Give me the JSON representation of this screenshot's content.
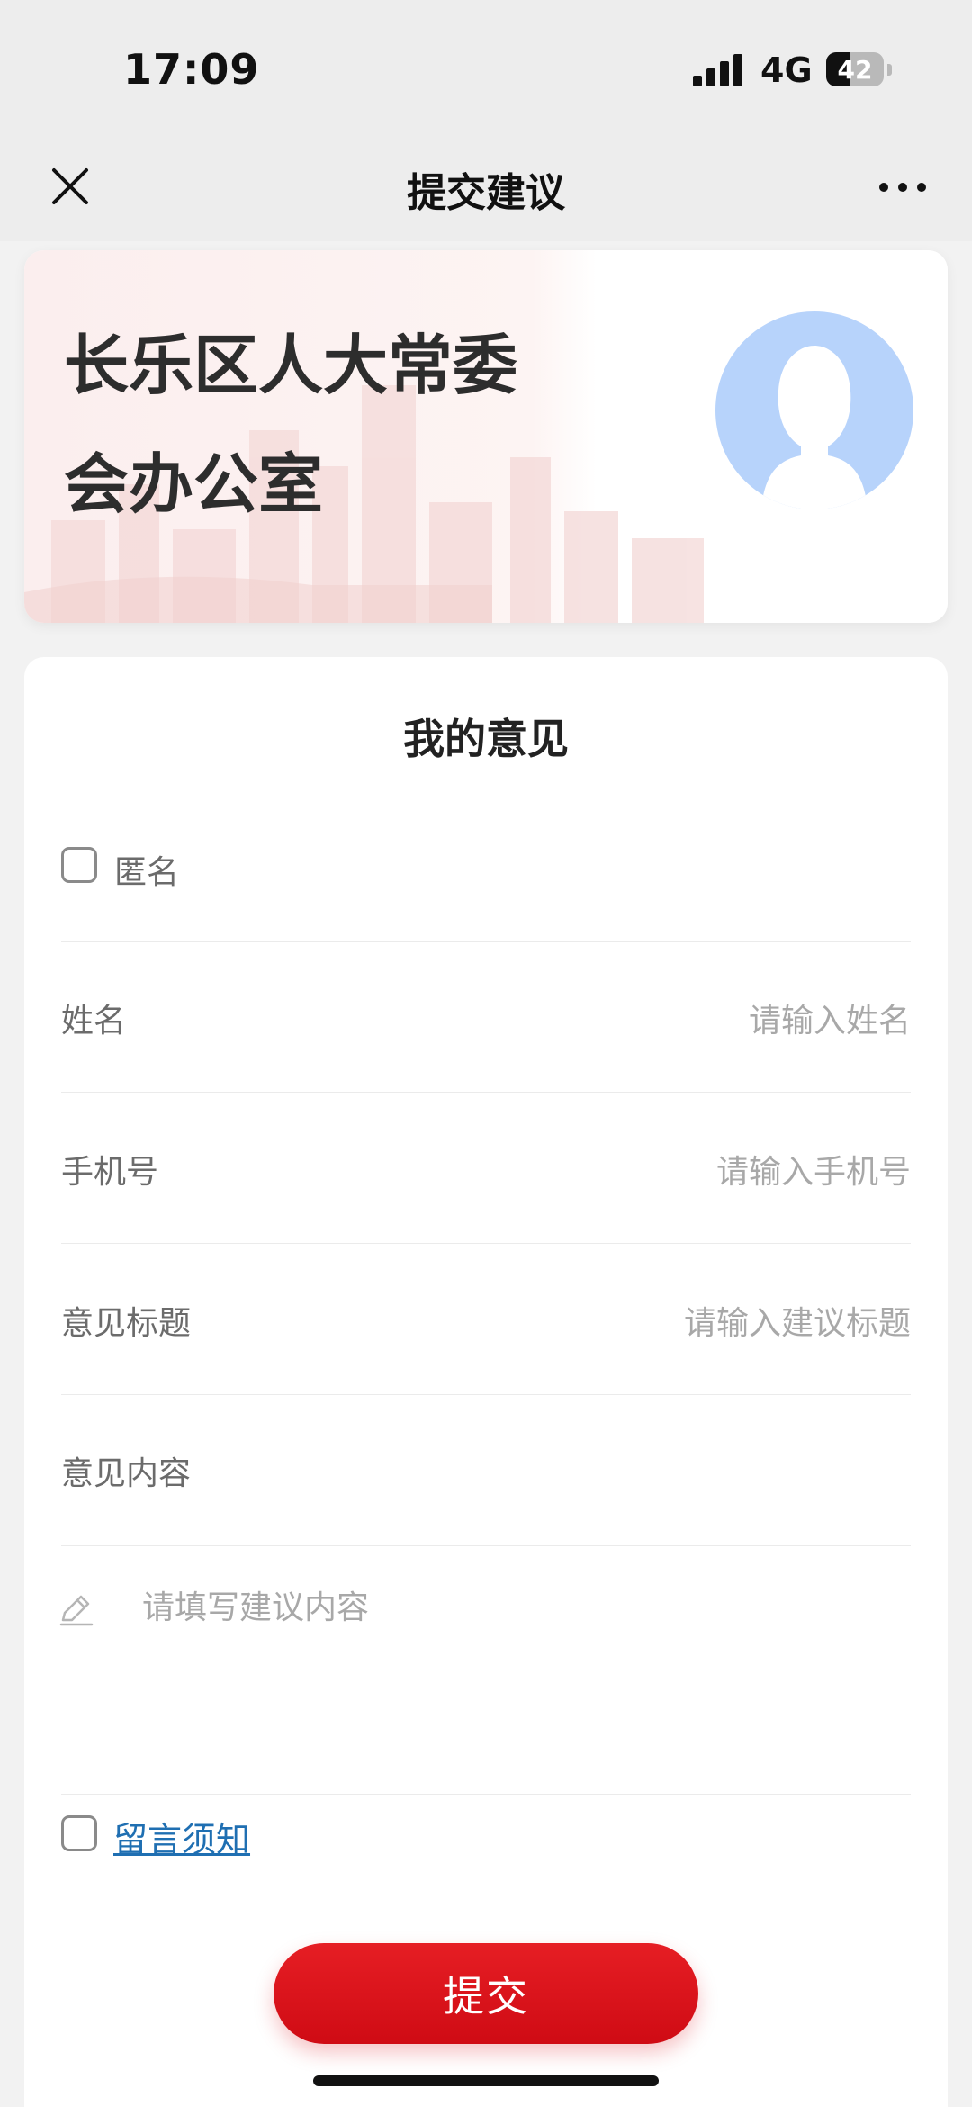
{
  "status_bar": {
    "time": "17:09",
    "network": "4G",
    "battery_percent": "42",
    "battery_level": 0.42
  },
  "nav": {
    "title": "提交建议",
    "close_icon": "close-icon",
    "more_icon": "more-dots-icon"
  },
  "banner": {
    "title_line1": "长乐区人大常委",
    "title_line2": "会办公室",
    "avatar_icon": "person-avatar-icon"
  },
  "form": {
    "heading": "我的意见",
    "anonymous_label": "匿名",
    "name_label": "姓名",
    "name_placeholder": "请输入姓名",
    "phone_label": "手机号",
    "phone_placeholder": "请输入手机号",
    "title_label": "意见标题",
    "title_placeholder": "请输入建议标题",
    "content_label": "意见内容",
    "content_placeholder": "请填写建议内容",
    "notice_link": "留言须知",
    "submit_label": "提交"
  },
  "colors": {
    "accent_red": "#d9121b",
    "link_blue": "#1f6fb2",
    "avatar_blue": "#b7d3fb"
  }
}
